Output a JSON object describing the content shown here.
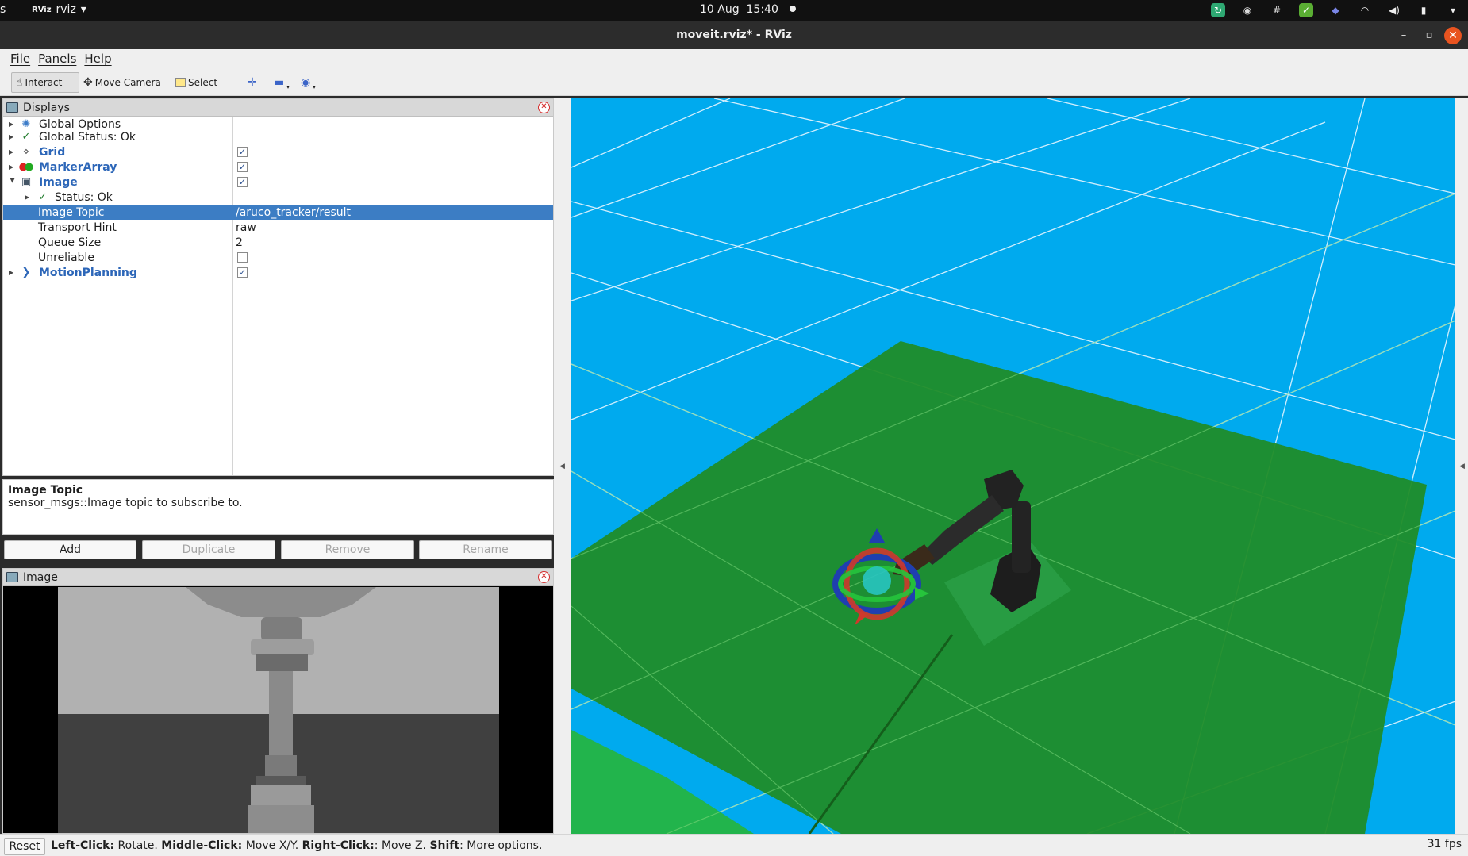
{
  "system_bar": {
    "left_edge": "s",
    "app_name": "rviz",
    "date": "10 Aug",
    "time": "15:40",
    "tray_icons": [
      "sync-icon",
      "discord-icon",
      "slack-icon",
      "check-shield-icon",
      "teams-icon",
      "wifi-icon",
      "volume-icon",
      "battery-icon"
    ]
  },
  "window": {
    "title": "moveit.rviz* - RViz",
    "minimize": "–",
    "maximize": "▫",
    "close": "✕"
  },
  "menu": [
    "File",
    "Panels",
    "Help"
  ],
  "toolbar": {
    "interact": "Interact",
    "move_camera": "Move Camera",
    "select": "Select"
  },
  "displays": {
    "title": "Displays",
    "items": [
      {
        "label": "Global Options",
        "icon": "globe-icon"
      },
      {
        "label": "Global Status: Ok",
        "icon": "check-icon"
      },
      {
        "label": "Grid",
        "icon": "grid-icon",
        "checked": true
      },
      {
        "label": "MarkerArray",
        "icon": "markers-icon",
        "checked": true
      },
      {
        "label": "Image",
        "icon": "image-icon",
        "checked": true
      },
      {
        "label": "Status: Ok",
        "icon": "check-icon"
      },
      {
        "label": "Image Topic",
        "value": "/aruco_tracker/result"
      },
      {
        "label": "Transport Hint",
        "value": "raw"
      },
      {
        "label": "Queue Size",
        "value": "2"
      },
      {
        "label": "Unreliable",
        "checked": false
      },
      {
        "label": "MotionPlanning",
        "icon": "motion-icon",
        "checked": true
      }
    ]
  },
  "description": {
    "title": "Image Topic",
    "text": "sensor_msgs::Image topic to subscribe to."
  },
  "buttons": {
    "add": "Add",
    "duplicate": "Duplicate",
    "remove": "Remove",
    "rename": "Rename"
  },
  "image_panel": {
    "title": "Image"
  },
  "status": {
    "reset": "Reset",
    "hint": [
      {
        "k": "Left-Click:",
        "v": " Rotate. "
      },
      {
        "k": "Middle-Click:",
        "v": " Move X/Y. "
      },
      {
        "k": "Right-Click:",
        "v": ": Move Z. "
      },
      {
        "k": "Shift",
        "v": ": More options."
      }
    ],
    "fps": "31 fps"
  },
  "colors": {
    "view_background": "#00aaee",
    "ground": "#1f8c28",
    "selection": "#3c7dc4"
  }
}
